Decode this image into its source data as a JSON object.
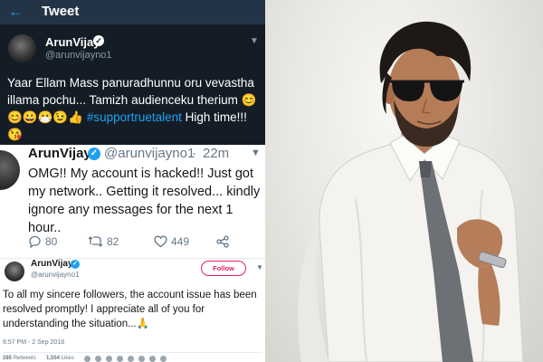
{
  "tweet_header": {
    "back_icon": "back-arrow-icon",
    "title": "Tweet"
  },
  "tweet1": {
    "name": "ArunVijay",
    "handle": "@arunvijayno1",
    "text": "Yaar Ellam Mass panuradhunnu oru vevastha illama pochu... Tamizh audienceku therium 😊😊😀😷😉👍",
    "hashtag": "#supportruetalent",
    "text_end": " High time!!! 😘"
  },
  "tweet2": {
    "name": "ArunVijay",
    "handle": "@arunvijayno1",
    "separator": "·",
    "time": "22m",
    "text": "OMG!! My account is hacked!! Just got my network.. Getting it resolved... kindly ignore any messages for the next 1 hour..",
    "replies": "80",
    "retweets": "82",
    "likes": "449"
  },
  "tweet3": {
    "name": "ArunVijay",
    "handle": "@arunvijayno1",
    "follow_label": "Follow",
    "text": "To all my sincere followers, the account issue has been resolved promptly! I appreciate all of you for understanding the situation...🙏",
    "timestamp": "6:57 PM - 2 Sep 2018",
    "retweets_count": "285",
    "retweets_label": "Retweets",
    "likes_count": "1,554",
    "likes_label": "Likes"
  },
  "colors": {
    "twitter_blue": "#1da1f2",
    "dark_background": "#141d26",
    "follow_pink": "#e0245e"
  }
}
